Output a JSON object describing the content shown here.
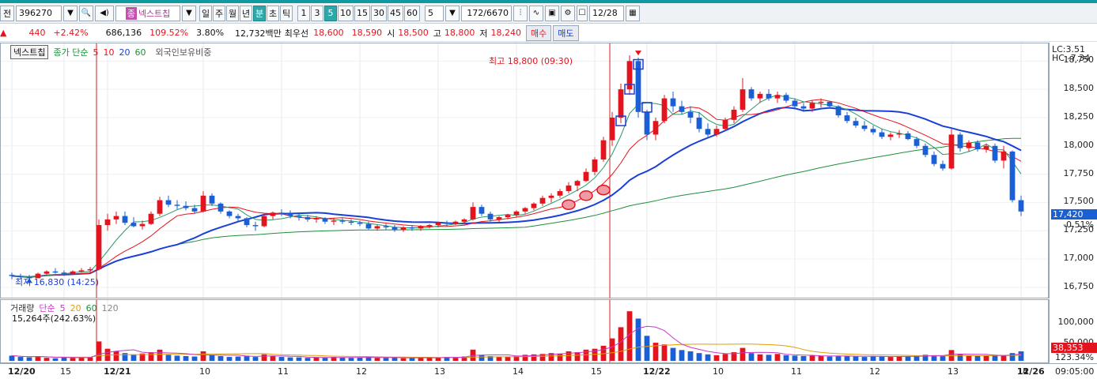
{
  "toolbar": {
    "label_prefix": "전",
    "code": "396270",
    "stock_badge": "종",
    "stock_name": "넥스트칩",
    "periods": [
      "일",
      "주",
      "월",
      "년",
      "분",
      "초",
      "틱"
    ],
    "minutes": [
      "1",
      "3",
      "5",
      "10",
      "15",
      "30",
      "45",
      "60"
    ],
    "selected_period": "분",
    "selected_minute": "5",
    "interval_value": "5",
    "page_counter": "172/6670",
    "date": "12/28"
  },
  "info": {
    "arrow": "▲",
    "change": "440",
    "change_pct": "+2.42%",
    "volume": "686,136",
    "vol_ratio": "109.52%",
    "turnover": "3.80%",
    "amount": "12,732백만",
    "pri_label": "최우선",
    "ask": "18,600",
    "bid": "18,590",
    "open_label": "시",
    "open": "18,500",
    "high_label": "고",
    "high": "18,800",
    "low_label": "저",
    "low": "18,240",
    "buy_btn": "매수",
    "sell_btn": "매도"
  },
  "price_panel": {
    "legend_name": "넥스트칩",
    "legend_ma_label": "종가 단순",
    "ma_periods": [
      "5",
      "10",
      "20",
      "60"
    ],
    "legend_extra": "외국인보유비중",
    "high_note": "최고 18,800 (09:30)",
    "low_note": "최저 16,830 (14:25)",
    "lc": "LC:3.51",
    "hc": "HC:-7.34",
    "current_price": "17,420",
    "current_pct": "-0.51%",
    "y_ticks": [
      "18,750",
      "18,500",
      "18,250",
      "18,000",
      "17,750",
      "17,500",
      "17,250",
      "17,000",
      "16,750"
    ]
  },
  "volume_panel": {
    "legend_name": "거래량",
    "legend_ma_label": "단순",
    "ma_periods": [
      "5",
      "20",
      "60",
      "120"
    ],
    "vol_text": "15,264주(242.63%)",
    "y_ticks": [
      "100,000",
      "50,000"
    ],
    "current_vol": "38,353",
    "current_vol_pct": "123.34%"
  },
  "x_axis": {
    "labels": [
      "12/20",
      "15",
      "12/21",
      "10",
      "11",
      "12",
      "13",
      "14",
      "15",
      "12/22",
      "10",
      "11",
      "12",
      "13",
      "14",
      "15",
      "12/26"
    ],
    "time": "09:05:00"
  },
  "colors": {
    "up": "#e4141e",
    "down": "#1a5fd4",
    "ma5": "#e4141e",
    "ma10": "#1a3fd8",
    "ma20": "#1f8f3a",
    "vol_ma5": "#c838c8",
    "vol_ma20": "#e0a000"
  },
  "chart_data": {
    "type": "candlestick",
    "y_range": [
      16700,
      18850
    ],
    "candles": [
      [
        16860,
        16880,
        16820,
        16850
      ],
      [
        16850,
        16870,
        16820,
        16840
      ],
      [
        16840,
        16860,
        16800,
        16830
      ],
      [
        16830,
        16880,
        16830,
        16870
      ],
      [
        16870,
        16900,
        16860,
        16890
      ],
      [
        16890,
        16920,
        16870,
        16880
      ],
      [
        16880,
        16900,
        16850,
        16870
      ],
      [
        16870,
        16900,
        16860,
        16890
      ],
      [
        16890,
        16920,
        16880,
        16900
      ],
      [
        16900,
        16930,
        16880,
        16910
      ],
      [
        16910,
        17350,
        16900,
        17300
      ],
      [
        17300,
        17400,
        17250,
        17350
      ],
      [
        17350,
        17420,
        17310,
        17380
      ],
      [
        17380,
        17420,
        17300,
        17320
      ],
      [
        17320,
        17370,
        17280,
        17290
      ],
      [
        17290,
        17340,
        17260,
        17310
      ],
      [
        17310,
        17420,
        17300,
        17400
      ],
      [
        17400,
        17550,
        17380,
        17520
      ],
      [
        17520,
        17560,
        17460,
        17480
      ],
      [
        17480,
        17520,
        17440,
        17470
      ],
      [
        17470,
        17510,
        17430,
        17450
      ],
      [
        17450,
        17480,
        17400,
        17420
      ],
      [
        17420,
        17600,
        17410,
        17560
      ],
      [
        17560,
        17580,
        17470,
        17490
      ],
      [
        17490,
        17500,
        17400,
        17420
      ],
      [
        17420,
        17430,
        17360,
        17380
      ],
      [
        17380,
        17400,
        17330,
        17360
      ],
      [
        17360,
        17370,
        17280,
        17300
      ],
      [
        17300,
        17330,
        17250,
        17290
      ],
      [
        17290,
        17400,
        17280,
        17380
      ],
      [
        17380,
        17420,
        17350,
        17410
      ],
      [
        17410,
        17440,
        17380,
        17400
      ],
      [
        17400,
        17430,
        17360,
        17380
      ],
      [
        17380,
        17400,
        17340,
        17370
      ],
      [
        17370,
        17390,
        17330,
        17350
      ],
      [
        17350,
        17380,
        17320,
        17360
      ],
      [
        17360,
        17370,
        17310,
        17330
      ],
      [
        17330,
        17360,
        17300,
        17340
      ],
      [
        17340,
        17360,
        17310,
        17330
      ],
      [
        17330,
        17350,
        17300,
        17320
      ],
      [
        17320,
        17340,
        17290,
        17310
      ],
      [
        17310,
        17330,
        17260,
        17270
      ],
      [
        17270,
        17300,
        17250,
        17290
      ],
      [
        17290,
        17310,
        17260,
        17280
      ],
      [
        17280,
        17300,
        17240,
        17260
      ],
      [
        17260,
        17290,
        17240,
        17280
      ],
      [
        17280,
        17300,
        17250,
        17270
      ],
      [
        17270,
        17300,
        17250,
        17290
      ],
      [
        17290,
        17310,
        17270,
        17300
      ],
      [
        17300,
        17330,
        17280,
        17320
      ],
      [
        17320,
        17340,
        17290,
        17310
      ],
      [
        17310,
        17340,
        17300,
        17330
      ],
      [
        17330,
        17360,
        17310,
        17350
      ],
      [
        17350,
        17500,
        17340,
        17460
      ],
      [
        17460,
        17480,
        17380,
        17400
      ],
      [
        17400,
        17420,
        17330,
        17350
      ],
      [
        17350,
        17380,
        17320,
        17370
      ],
      [
        17370,
        17400,
        17350,
        17390
      ],
      [
        17390,
        17430,
        17370,
        17420
      ],
      [
        17420,
        17460,
        17400,
        17450
      ],
      [
        17450,
        17500,
        17430,
        17490
      ],
      [
        17490,
        17560,
        17470,
        17540
      ],
      [
        17540,
        17580,
        17500,
        17560
      ],
      [
        17560,
        17620,
        17540,
        17600
      ],
      [
        17600,
        17680,
        17580,
        17650
      ],
      [
        17650,
        17700,
        17600,
        17690
      ],
      [
        17690,
        17800,
        17680,
        17770
      ],
      [
        17770,
        17900,
        17740,
        17880
      ],
      [
        17880,
        18080,
        17860,
        18050
      ],
      [
        18050,
        18300,
        18000,
        18250
      ],
      [
        18250,
        18550,
        18200,
        18500
      ],
      [
        18500,
        18800,
        18450,
        18750
      ],
      [
        18750,
        18780,
        18250,
        18300
      ],
      [
        18300,
        18320,
        18050,
        18100
      ],
      [
        18100,
        18250,
        18050,
        18220
      ],
      [
        18220,
        18450,
        18200,
        18420
      ],
      [
        18420,
        18480,
        18300,
        18350
      ],
      [
        18350,
        18400,
        18280,
        18300
      ],
      [
        18300,
        18350,
        18200,
        18250
      ],
      [
        18250,
        18300,
        18120,
        18150
      ],
      [
        18150,
        18200,
        18080,
        18100
      ],
      [
        18100,
        18180,
        18080,
        18150
      ],
      [
        18150,
        18250,
        18130,
        18230
      ],
      [
        18230,
        18350,
        18200,
        18320
      ],
      [
        18320,
        18600,
        18300,
        18500
      ],
      [
        18500,
        18520,
        18400,
        18420
      ],
      [
        18420,
        18480,
        18380,
        18460
      ],
      [
        18460,
        18500,
        18400,
        18420
      ],
      [
        18420,
        18480,
        18380,
        18450
      ],
      [
        18450,
        18470,
        18380,
        18400
      ],
      [
        18400,
        18420,
        18320,
        18350
      ],
      [
        18350,
        18380,
        18300,
        18330
      ],
      [
        18330,
        18400,
        18300,
        18380
      ],
      [
        18380,
        18420,
        18340,
        18390
      ],
      [
        18390,
        18400,
        18330,
        18350
      ],
      [
        18350,
        18360,
        18250,
        18270
      ],
      [
        18270,
        18300,
        18200,
        18220
      ],
      [
        18220,
        18250,
        18160,
        18180
      ],
      [
        18180,
        18220,
        18130,
        18150
      ],
      [
        18150,
        18180,
        18100,
        18120
      ],
      [
        18120,
        18150,
        18060,
        18080
      ],
      [
        18080,
        18120,
        18050,
        18100
      ],
      [
        18100,
        18140,
        18070,
        18110
      ],
      [
        18110,
        18130,
        18050,
        18060
      ],
      [
        18060,
        18080,
        17980,
        18000
      ],
      [
        18000,
        18020,
        17900,
        17920
      ],
      [
        17920,
        17950,
        17820,
        17840
      ],
      [
        17840,
        17870,
        17780,
        17800
      ],
      [
        17800,
        18150,
        17790,
        18100
      ],
      [
        18100,
        18120,
        17950,
        17980
      ],
      [
        17980,
        18050,
        17950,
        18030
      ],
      [
        18030,
        18050,
        17950,
        17970
      ],
      [
        17970,
        18020,
        17940,
        18000
      ],
      [
        18000,
        18020,
        17850,
        17870
      ],
      [
        17870,
        18000,
        17800,
        17950
      ],
      [
        17950,
        17960,
        17500,
        17520
      ],
      [
        17520,
        17560,
        17380,
        17420
      ]
    ],
    "volume_range": [
      0,
      130000
    ],
    "volumes": [
      12000,
      9000,
      8000,
      11000,
      7000,
      6000,
      8000,
      7000,
      9000,
      8000,
      45000,
      28000,
      22000,
      18000,
      15000,
      17000,
      20000,
      26000,
      14000,
      12000,
      11000,
      10000,
      22000,
      13000,
      11000,
      9000,
      10000,
      12000,
      9000,
      15000,
      11000,
      9000,
      8000,
      8000,
      7000,
      8000,
      7000,
      9000,
      8000,
      7000,
      8000,
      9000,
      7000,
      7000,
      8000,
      6000,
      7000,
      8000,
      7000,
      8000,
      9000,
      8000,
      10000,
      26000,
      14000,
      11000,
      9000,
      10000,
      12000,
      14000,
      15000,
      16000,
      18000,
      17000,
      22000,
      20000,
      26000,
      28000,
      35000,
      52000,
      78000,
      115000,
      98000,
      58000,
      42000,
      38000,
      30000,
      25000,
      22000,
      18000,
      15000,
      13000,
      16000,
      20000,
      30000,
      18000,
      15000,
      14000,
      16000,
      13000,
      12000,
      11000,
      12000,
      11000,
      10000,
      12000,
      11000,
      10000,
      9000,
      11000,
      10000,
      9000,
      11000,
      10000,
      12000,
      14000,
      13000,
      11000,
      25000,
      16000,
      12000,
      11000,
      12000,
      14000,
      13000,
      18000,
      22000
    ]
  }
}
